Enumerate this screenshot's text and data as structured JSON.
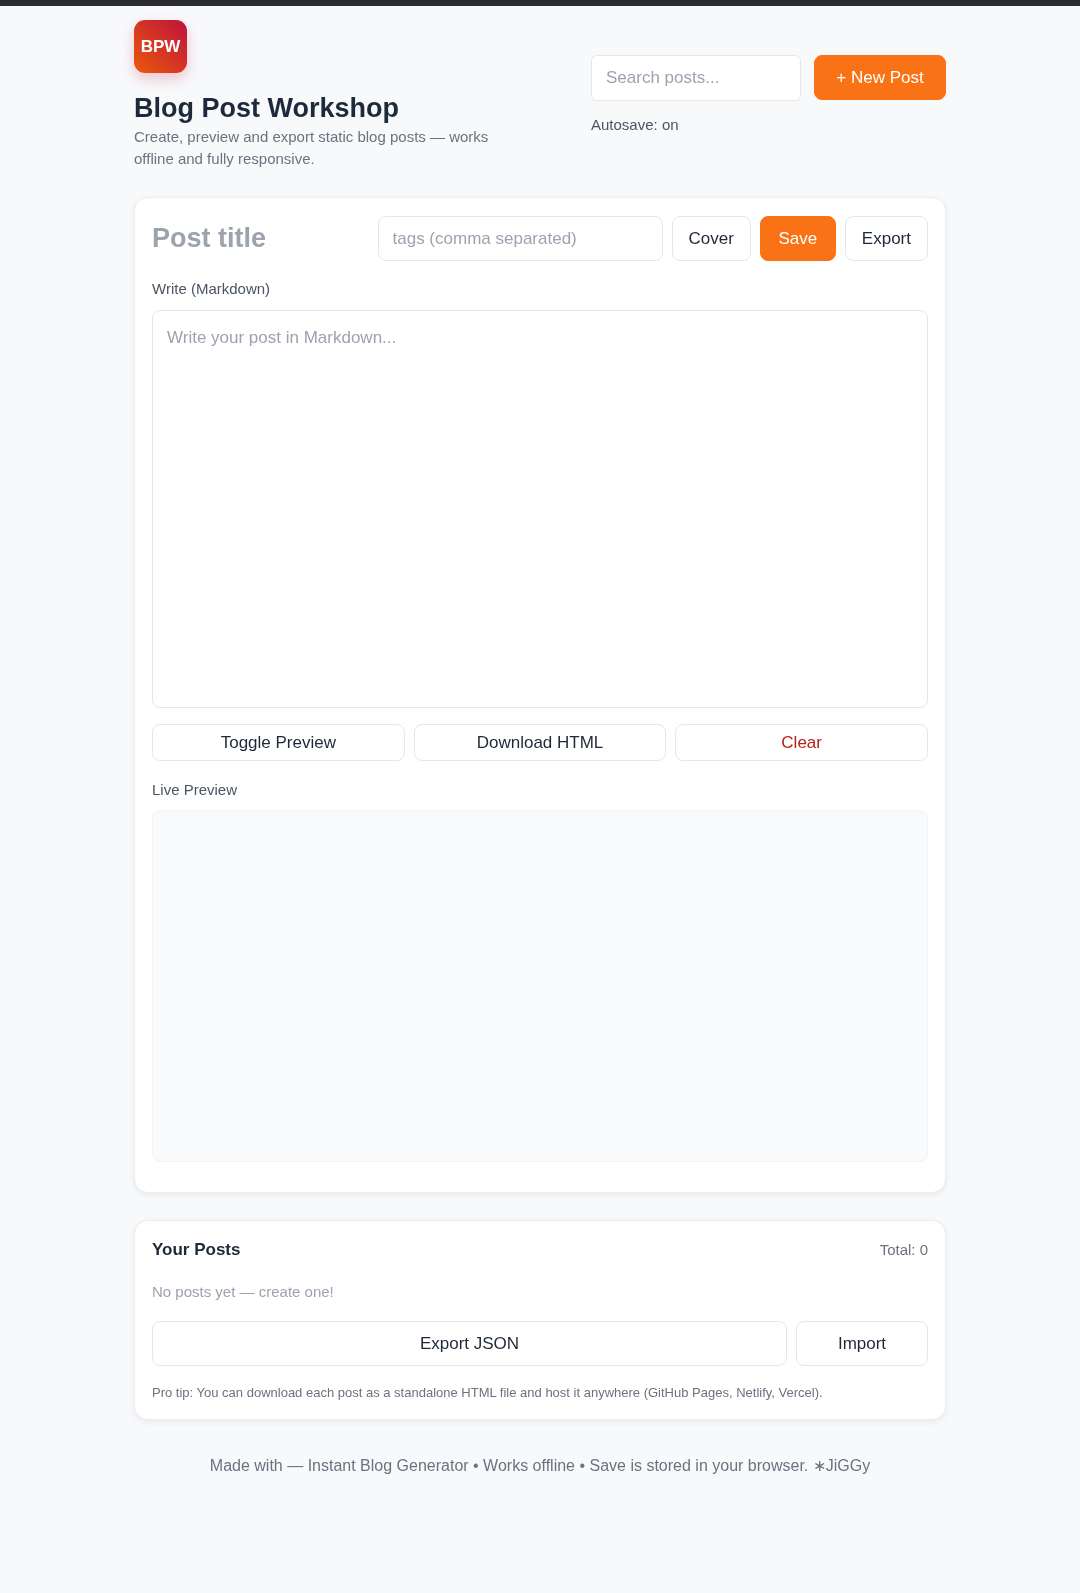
{
  "header": {
    "logo": "BPW",
    "title": "Blog Post Workshop",
    "subtitle": "Create, preview and export static blog posts — works offline and fully responsive.",
    "search": {
      "placeholder": "Search posts..."
    },
    "new_post_button": "+ New Post",
    "autosave": "Autosave: on"
  },
  "editor": {
    "title_field": {
      "placeholder": "Post title"
    },
    "tags_field": {
      "placeholder": "tags (comma separated)"
    },
    "toolbar_buttons": [
      {
        "label": "Cover",
        "kind": "default"
      },
      {
        "label": "Save",
        "kind": "primary"
      },
      {
        "label": "Export",
        "kind": "default"
      }
    ],
    "write_label": "Write (Markdown)",
    "markdown_field": {
      "placeholder": "Write your post in Markdown..."
    },
    "actions": [
      {
        "label": "Toggle Preview",
        "kind": "default"
      },
      {
        "label": "Download HTML",
        "kind": "default"
      },
      {
        "label": "Clear",
        "kind": "danger"
      }
    ],
    "preview_label": "Live Preview"
  },
  "posts": {
    "title": "Your Posts",
    "total": "Total: 0",
    "empty_message": "No posts yet — create one!",
    "buttons": [
      "Export JSON",
      "Import"
    ],
    "tip": "Pro tip: You can download each post as a standalone HTML file and host it anywhere (GitHub Pages, Netlify, Vercel)."
  },
  "footer": "Made with — Instant Blog Generator • Works offline • Save is stored in your browser. ∗JiGGy"
}
